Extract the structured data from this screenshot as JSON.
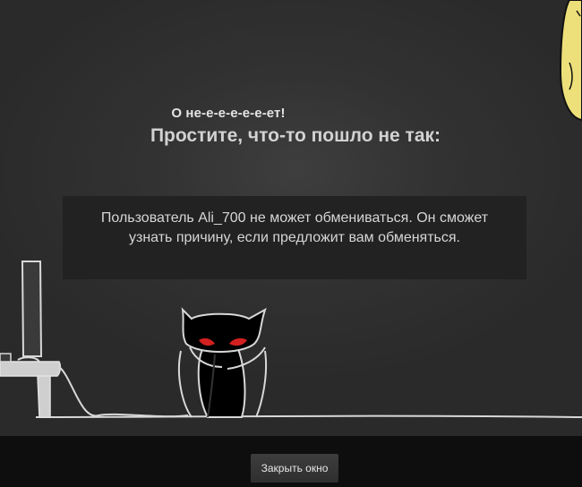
{
  "dialog": {
    "exclamation": "О не-е-е-е-е-е-ет!",
    "apology": "Простите, что-то пошло не так:",
    "message": "Пользователь Ali_700 не может обмениваться. Он сможет узнать причину, если предложит вам обменяться."
  },
  "footer": {
    "close_label": "Закрыть окно"
  },
  "illustration": {
    "character": "cat-icon",
    "desk": "computer-desk-icon",
    "corner_creature": "yellow-creature-icon"
  },
  "colors": {
    "background": "#2f2f2f",
    "message_box": "#222222",
    "footer": "#0e0e0e",
    "eyes": "#d32020",
    "creature": "#ede07a"
  }
}
